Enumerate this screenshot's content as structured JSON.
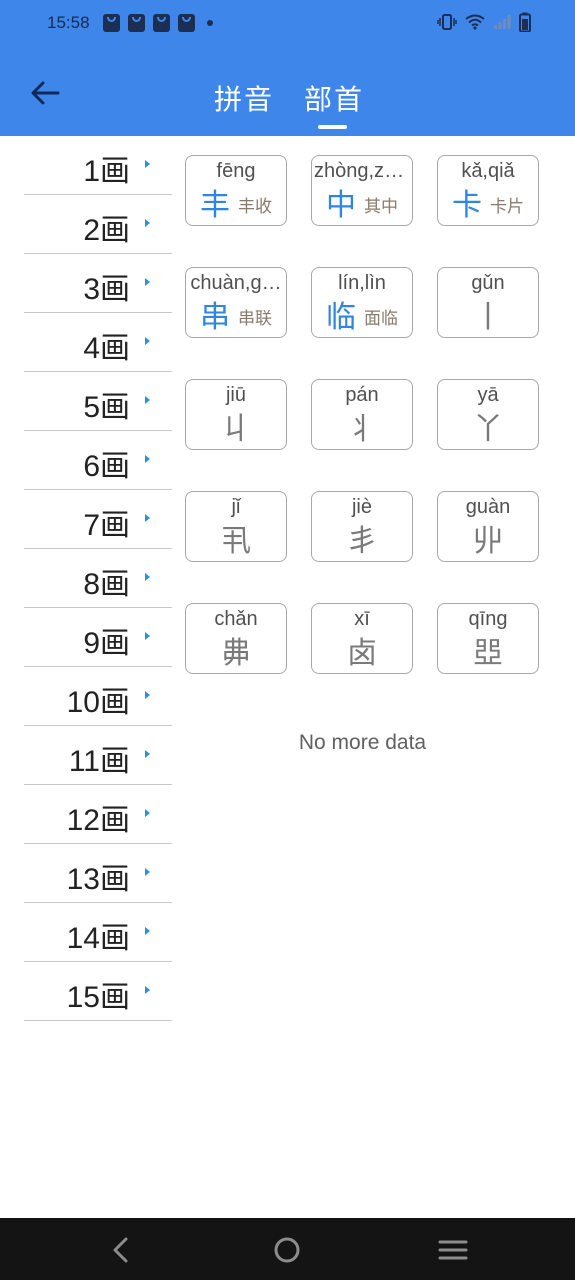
{
  "status_bar": {
    "time": "15:58"
  },
  "header": {
    "tabs": [
      {
        "label": "拼音"
      },
      {
        "label": "部首"
      }
    ],
    "active_tab": "部首"
  },
  "stroke_list": [
    {
      "label": "1画"
    },
    {
      "label": "2画"
    },
    {
      "label": "3画"
    },
    {
      "label": "4画"
    },
    {
      "label": "5画"
    },
    {
      "label": "6画"
    },
    {
      "label": "7画"
    },
    {
      "label": "8画"
    },
    {
      "label": "9画"
    },
    {
      "label": "10画"
    },
    {
      "label": "11画"
    },
    {
      "label": "12画"
    },
    {
      "label": "13画"
    },
    {
      "label": "14画"
    },
    {
      "label": "15画"
    }
  ],
  "radicals": [
    {
      "pinyin": "fēng",
      "char": "丰",
      "word": "丰收"
    },
    {
      "pinyin": "zhòng,zh…",
      "char": "中",
      "word": "其中"
    },
    {
      "pinyin": "kǎ,qiǎ",
      "char": "卡",
      "word": "卡片"
    },
    {
      "pinyin": "chuàn,g…",
      "char": "串",
      "word": "串联"
    },
    {
      "pinyin": "lín,lìn",
      "char": "临",
      "word": "面临"
    },
    {
      "pinyin": "gǔn",
      "char": "丨",
      "word": ""
    },
    {
      "pinyin": "jiū",
      "char": "丩",
      "word": ""
    },
    {
      "pinyin": "pán",
      "char": "丬",
      "word": ""
    },
    {
      "pinyin": "yā",
      "char": "丫",
      "word": ""
    },
    {
      "pinyin": "jǐ",
      "char": "丮",
      "word": ""
    },
    {
      "pinyin": "jiè",
      "char": "丯",
      "word": ""
    },
    {
      "pinyin": "guàn",
      "char": "丱",
      "word": ""
    },
    {
      "pinyin": "chǎn",
      "char": "丳",
      "word": ""
    },
    {
      "pinyin": "xī",
      "char": "卤",
      "word": ""
    },
    {
      "pinyin": "qīng",
      "char": "𠁁",
      "word": ""
    }
  ],
  "list_footer": "No more data",
  "colors": {
    "header_bg": "#3f86eb",
    "accent_blue": "#2e86e0",
    "arrow": "#2f8fd8",
    "nav_bg": "#141414"
  },
  "icons": {
    "back": "arrow-left-icon",
    "nav_back": "nav-back-icon",
    "nav_home": "nav-home-icon",
    "nav_menu": "nav-menu-icon"
  }
}
